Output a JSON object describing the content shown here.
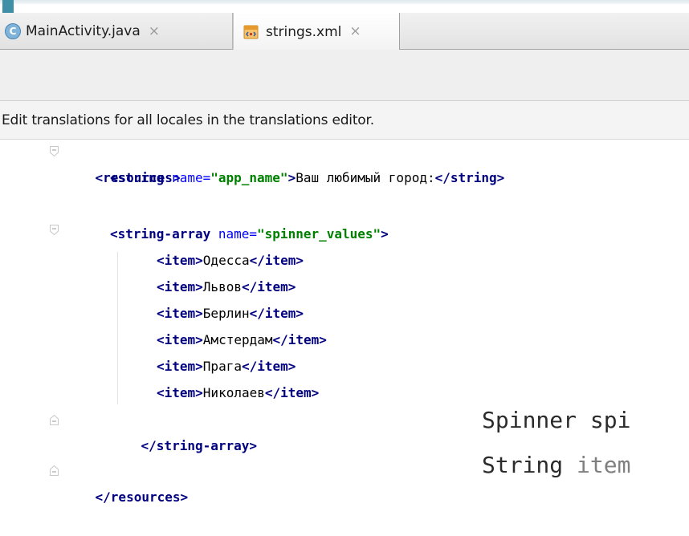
{
  "tabs": [
    {
      "label": "MainActivity.java",
      "icon": "class-icon",
      "icon_glyph": "C",
      "close": "×"
    },
    {
      "label": "strings.xml",
      "icon": "xml-file-icon",
      "close": "×",
      "active": true
    }
  ],
  "banner": {
    "text": "Edit translations for all locales in the translations editor."
  },
  "code": {
    "resources_open": "<resources>",
    "string_open": "<string ",
    "string_attr": "name=",
    "string_val": "\"app_name\"",
    "string_gt": ">",
    "string_text": "Ваш любимый город:",
    "string_close": "</string>",
    "array_open": "<string-array ",
    "array_attr": "name=",
    "array_val": "\"spinner_values\"",
    "array_gt": ">",
    "items": [
      "Одесса",
      "Львов",
      "Берлин",
      "Амстердам",
      "Прага",
      "Николаев"
    ],
    "item_open": "<item>",
    "item_close": "</item>",
    "array_close": "</string-array>",
    "resources_close": "</resources>"
  },
  "overlay": {
    "line1": "Spinner spi",
    "line2_kw": "String ",
    "line2_rest": "item"
  },
  "colors": {
    "tag": "#000080",
    "attribute": "#0000ff",
    "value": "#008000",
    "accent": "#3f8fa7"
  }
}
